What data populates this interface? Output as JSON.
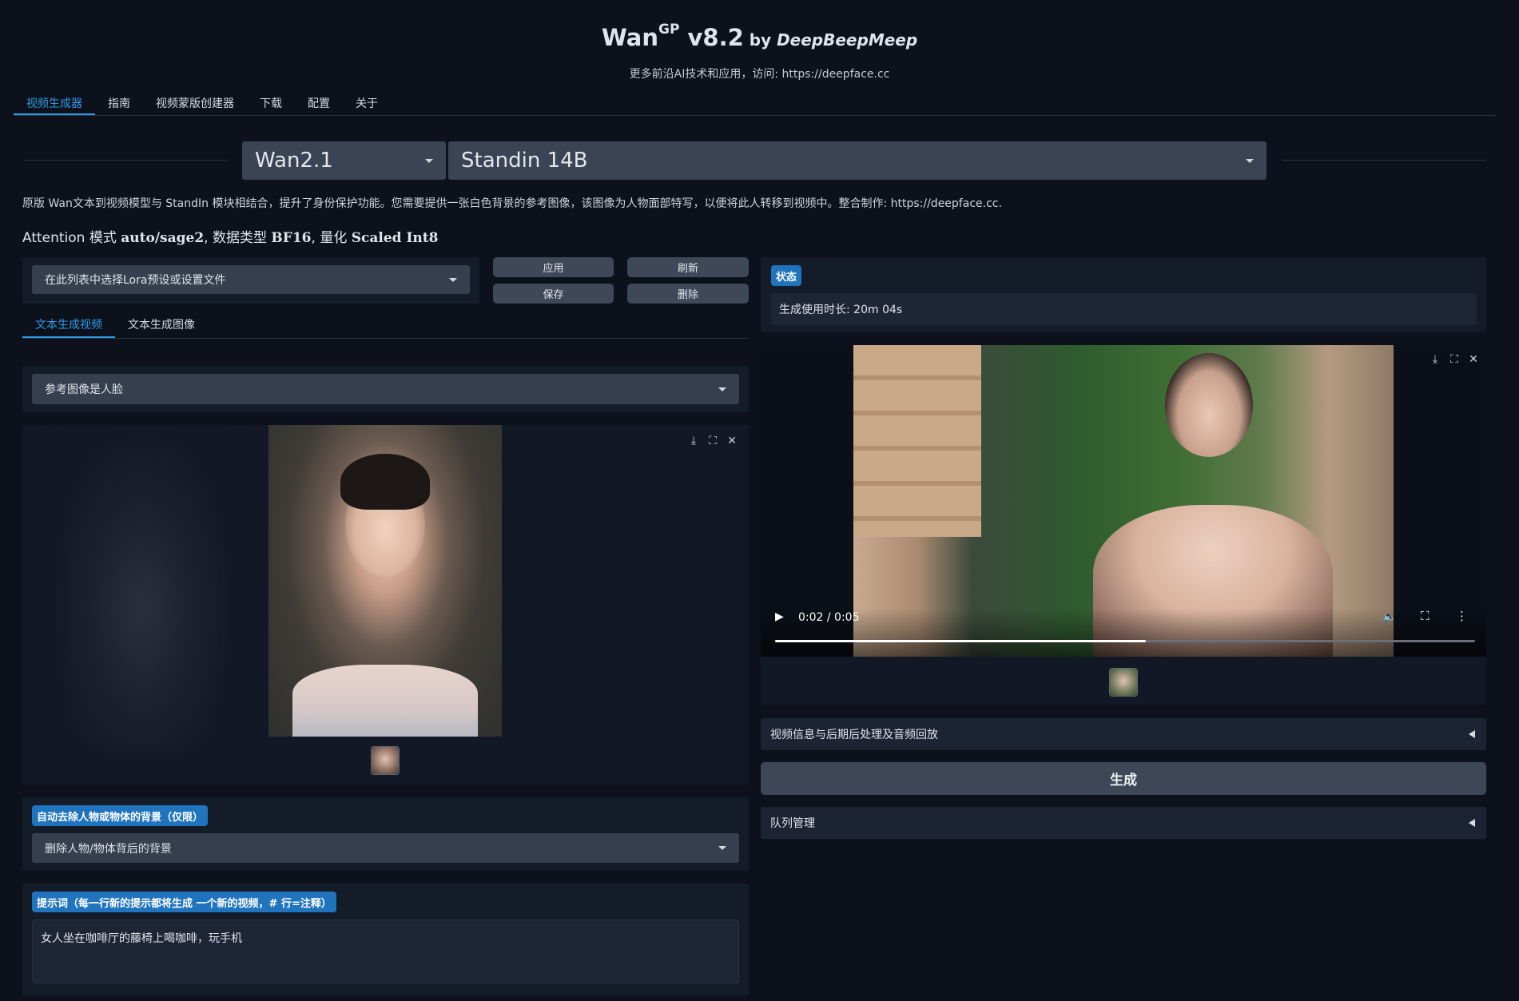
{
  "header": {
    "title_main": "Wan",
    "title_sup": "GP",
    "title_version": " v8.2",
    "title_by": " by ",
    "title_author": "DeepBeepMeep",
    "subtitle": "更多前沿AI技术和应用，访问: https://deepface.cc"
  },
  "tabs": [
    {
      "label": "视频生成器",
      "active": true
    },
    {
      "label": "指南"
    },
    {
      "label": "视频蒙版创建器"
    },
    {
      "label": "下载"
    },
    {
      "label": "配置"
    },
    {
      "label": "关于"
    }
  ],
  "model": {
    "family": "Wan2.1",
    "name": "Standin 14B"
  },
  "description": "原版 Wan文本到视频模型与 StandIn 模块相结合，提升了身份保护功能。您需要提供一张白色背景的参考图像，该图像为人物面部特写，以便将此人转移到视频中。整合制作: https://deepface.cc.",
  "attention": {
    "prefix": "Attention 模式 ",
    "mode": "auto/sage2",
    "mid1": ", 数据类型 ",
    "dtype": "BF16",
    "mid2": ", 量化 ",
    "quant": "Scaled Int8"
  },
  "lora": {
    "placeholder": "在此列表中选择Lora预设或设置文件",
    "apply": "应用",
    "refresh": "刷新",
    "save": "保存",
    "delete": "删除"
  },
  "gen_tabs": [
    {
      "label": "文本生成视频",
      "active": true
    },
    {
      "label": "文本生成图像"
    }
  ],
  "ref_image_mode": "参考图像是人脸",
  "bg_removal": {
    "label": "自动去除人物或物体的背景（仅限）",
    "value": "删除人物/物体背后的背景"
  },
  "prompt": {
    "label": "提示词（每一行新的提示都将生成 一个新的视频，# 行=注释）",
    "value": "女人坐在咖啡厅的藤椅上喝咖啡，玩手机"
  },
  "status": {
    "label": "状态",
    "value": "生成使用时长: 20m 04s"
  },
  "video": {
    "time": "0:02 / 0:05",
    "progress": 0.53
  },
  "video_info_accordion": "视频信息与后期后处理及音频回放",
  "generate_button": "生成",
  "queue_accordion": "队列管理",
  "colors": {
    "background": "#0c111c",
    "panel": "#141b29",
    "accent": "#2f9be6",
    "badge": "#1f74bd",
    "button": "#3f4858"
  },
  "icons": [
    "download-icon",
    "fullscreen-icon",
    "close-icon",
    "play-icon",
    "volume-icon",
    "more-icon"
  ]
}
